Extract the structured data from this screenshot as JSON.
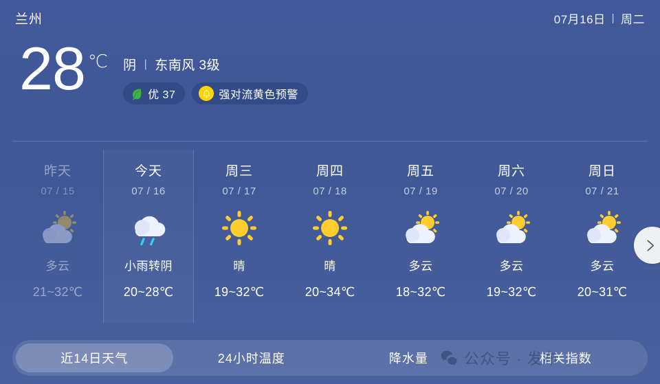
{
  "header": {
    "city": "兰州",
    "date": "07月16日",
    "separator": "|",
    "weekday": "周二"
  },
  "current": {
    "temperature": "28",
    "unit": "℃",
    "condition": "阴",
    "separator": "|",
    "wind": "东南风 3级",
    "air_quality": {
      "icon": "leaf-icon",
      "label": "优 37"
    },
    "alert": {
      "icon": "bell-icon",
      "label": "强对流黄色预警",
      "icon_color": "#FFD400"
    }
  },
  "forecast": {
    "days": [
      {
        "name": "昨天",
        "date": "07 / 15",
        "icon": "partly-cloudy-icon",
        "desc": "多云",
        "temp": "21~32℃",
        "state": "past"
      },
      {
        "name": "今天",
        "date": "07 / 16",
        "icon": "light-rain-icon",
        "desc": "小雨转阴",
        "temp": "20~28℃",
        "state": "today"
      },
      {
        "name": "周三",
        "date": "07 / 17",
        "icon": "sunny-icon",
        "desc": "晴",
        "temp": "19~32℃",
        "state": "future"
      },
      {
        "name": "周四",
        "date": "07 / 18",
        "icon": "sunny-icon",
        "desc": "晴",
        "temp": "20~34℃",
        "state": "future"
      },
      {
        "name": "周五",
        "date": "07 / 19",
        "icon": "partly-cloudy-icon",
        "desc": "多云",
        "temp": "18~32℃",
        "state": "future"
      },
      {
        "name": "周六",
        "date": "07 / 20",
        "icon": "partly-cloudy-icon",
        "desc": "多云",
        "temp": "19~32℃",
        "state": "future"
      },
      {
        "name": "周日",
        "date": "07 / 21",
        "icon": "partly-cloudy-icon",
        "desc": "多云",
        "temp": "20~31℃",
        "state": "future"
      }
    ],
    "next_button_icon": "chevron-right-icon"
  },
  "tabs": [
    {
      "label": "近14日天气",
      "active": true
    },
    {
      "label": "24小时温度",
      "active": false
    },
    {
      "label": "降水量",
      "active": false
    },
    {
      "label": "相关指数",
      "active": false
    }
  ],
  "watermark": {
    "icon": "wechat-icon",
    "text": "公众号 · 发布"
  },
  "colors": {
    "background": "#41589a",
    "accent_yellow": "#FFD400",
    "leaf_green": "#3cb44a",
    "rain_blue": "#2fd0f0"
  }
}
